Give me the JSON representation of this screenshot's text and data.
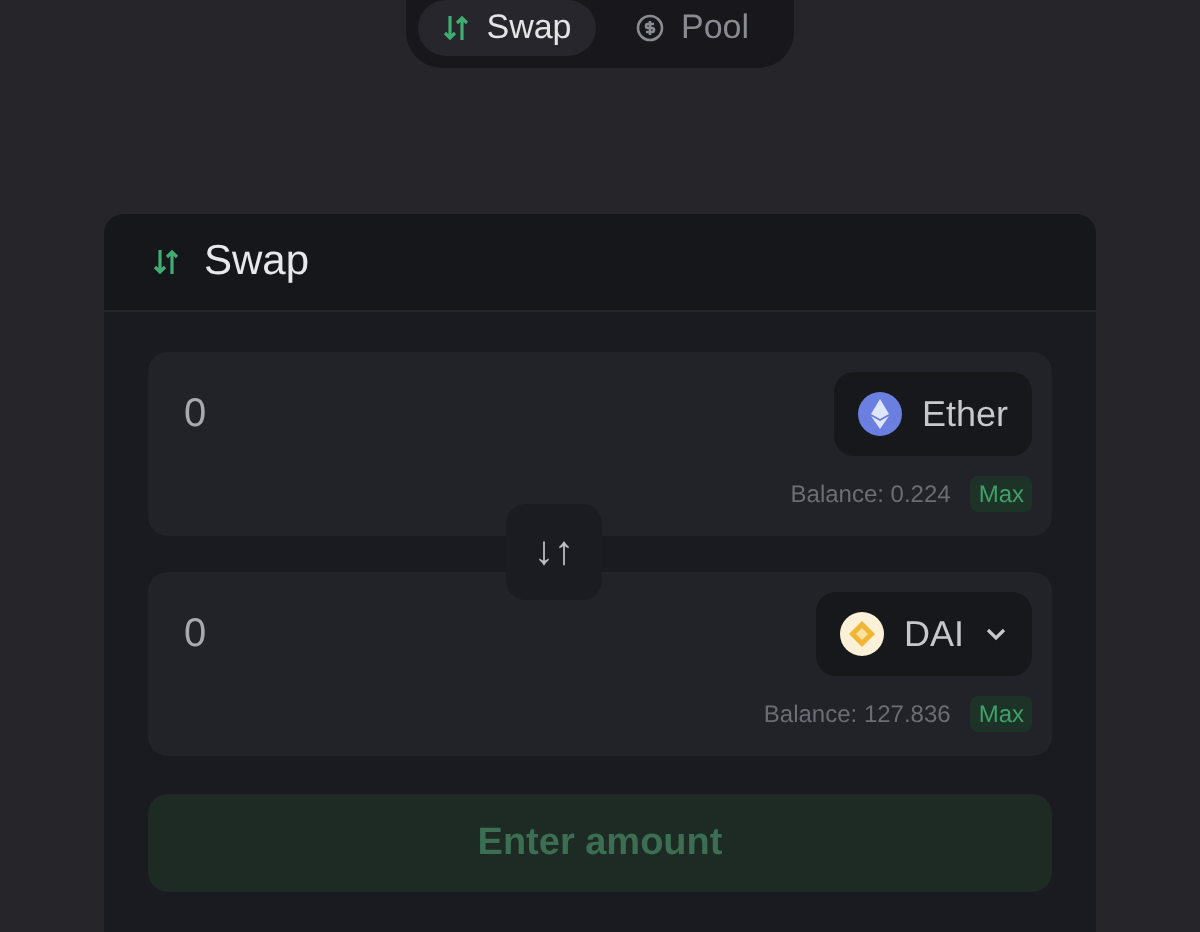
{
  "nav_tabs": [
    {
      "label": "Swap",
      "selected": true,
      "kind": "swap"
    },
    {
      "label": "Pool",
      "selected": false,
      "kind": "coin"
    }
  ],
  "card": {
    "title": "Swap",
    "inputs": [
      {
        "amount": "0",
        "token": "Ether",
        "kind": "eth",
        "dropdown": false,
        "balance": "Balance: 0.224",
        "max": "Max"
      },
      {
        "amount": "0",
        "token": "DAI",
        "kind": "dai",
        "dropdown": true,
        "balance": "Balance: 127.836",
        "max": "Max"
      }
    ],
    "switch_label": "↓↑",
    "submit": {
      "label": "Enter amount",
      "disabled": true
    }
  }
}
